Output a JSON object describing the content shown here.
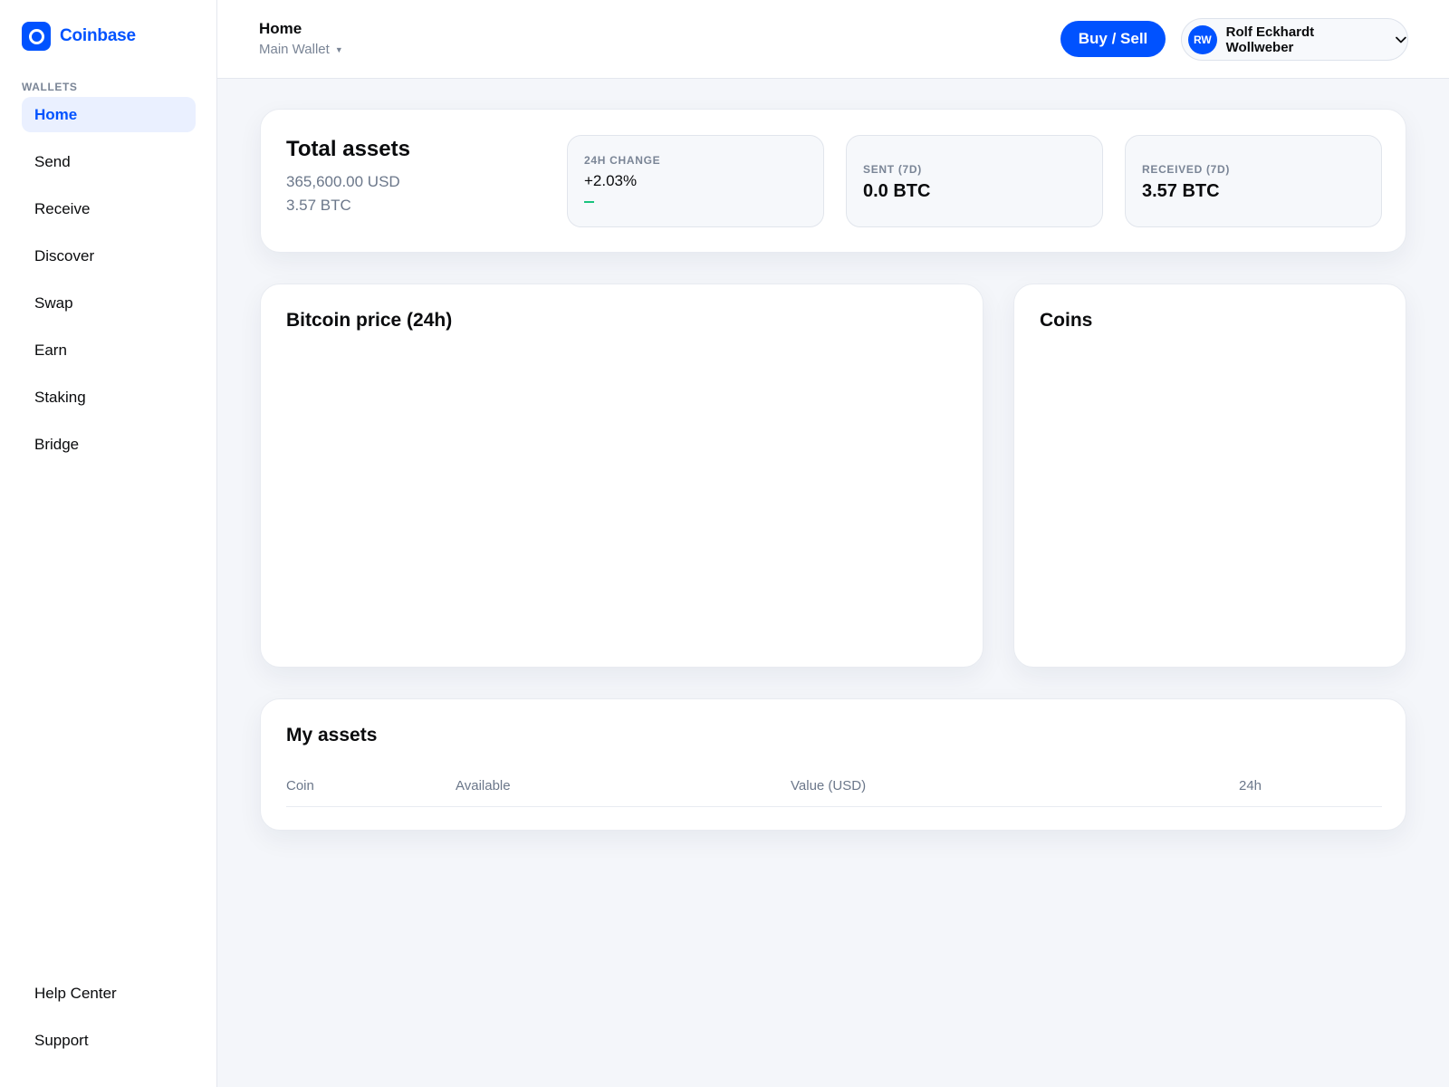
{
  "brand": {
    "name": "Coinbase",
    "accent": "#0052ff"
  },
  "sidebar": {
    "section_label": "WALLETS",
    "items": [
      {
        "label": "Home",
        "active": true
      },
      {
        "label": "Send"
      },
      {
        "label": "Receive"
      },
      {
        "label": "Discover"
      },
      {
        "label": "Swap"
      },
      {
        "label": "Earn"
      },
      {
        "label": "Staking"
      },
      {
        "label": "Bridge"
      }
    ],
    "bottom_items": [
      {
        "label": "Help Center"
      },
      {
        "label": "Support"
      }
    ]
  },
  "header": {
    "title": "Home",
    "wallet": "Main Wallet",
    "buy_sell_label": "Buy / Sell",
    "user": {
      "initials": "RW",
      "name": "Rolf Eckhardt Wollweber"
    }
  },
  "summary": {
    "title": "Total assets",
    "usd": "365,600.00 USD",
    "btc": "3.57 BTC",
    "change": {
      "label": "24H CHANGE",
      "value": "+2.03%",
      "trend_color": "#19c37d"
    },
    "sent": {
      "label": "SENT (7D)",
      "value": "0.0 BTC"
    },
    "received": {
      "label": "RECEIVED (7D)",
      "value": "3.57 BTC"
    }
  },
  "price_chart": {
    "title": "Bitcoin price (24h)"
  },
  "coins": {
    "title": "Coins"
  },
  "assets": {
    "title": "My assets",
    "columns": [
      "Coin",
      "Available",
      "Value (USD)",
      "24h"
    ]
  }
}
